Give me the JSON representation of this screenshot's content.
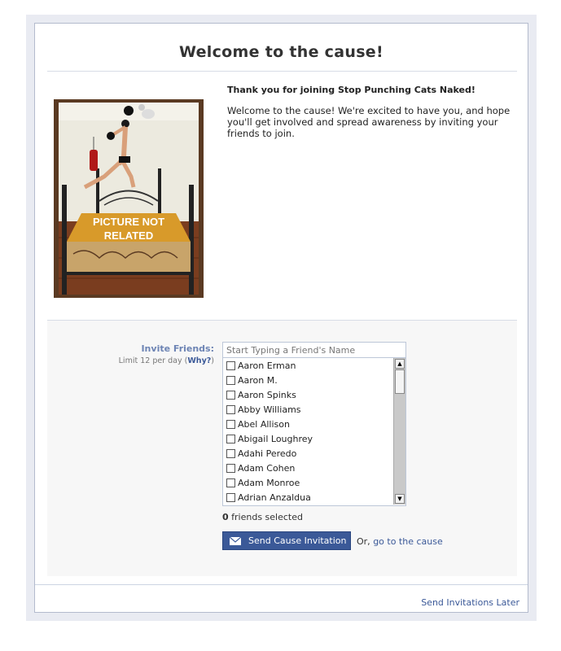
{
  "dialog": {
    "title": "Welcome to the cause!"
  },
  "photo": {
    "caption_line1": "PICTURE NOT",
    "caption_line2": "RELATED"
  },
  "intro": {
    "thanks": "Thank you for joining Stop Punching Cats Naked!",
    "welcome": "Welcome to the cause! We're excited to have you, and hope you'll get involved and spread awareness by inviting your friends to join."
  },
  "invite": {
    "label": "Invite Friends:",
    "limit_text": "Limit 12 per day",
    "why_text": "Why?",
    "search_placeholder": "Start Typing a Friend's Name",
    "friends": [
      "Aaron Erman",
      "Aaron M.",
      "Aaron Spinks",
      "Abby Williams",
      "Abel Allison",
      "Abigail Loughrey",
      "Adahi Peredo",
      "Adam Cohen",
      "Adam Monroe",
      "Adrian Anzaldua"
    ],
    "selected_count": "0",
    "selected_suffix": "friends selected",
    "send_label": "Send Cause Invitation",
    "or_text": "Or,",
    "goto_text": "go to the cause"
  },
  "footer": {
    "later_text": "Send Invitations Later"
  },
  "colors": {
    "brand": "#3b5998",
    "label_blue": "#6d84b4",
    "panel_bg": "#f7f7f7"
  }
}
